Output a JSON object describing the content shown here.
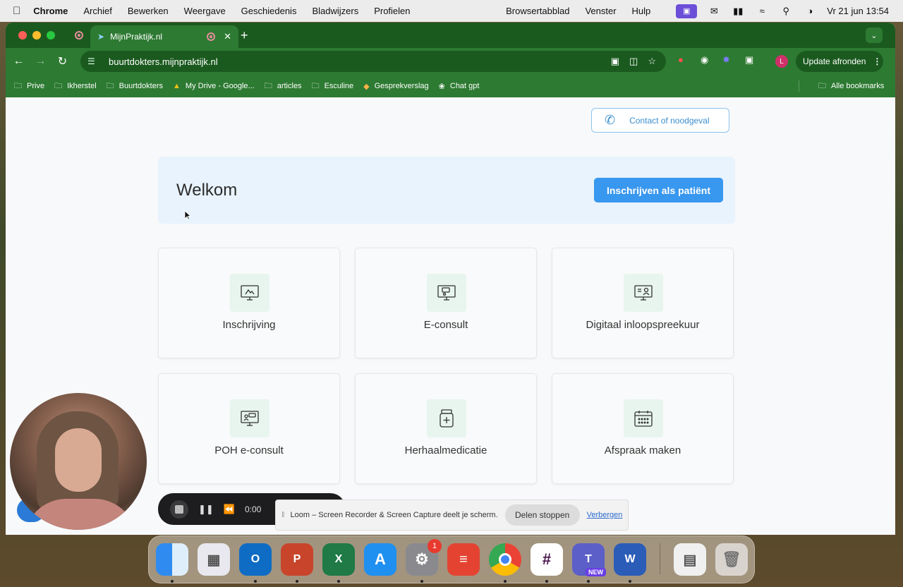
{
  "menubar": {
    "apple": "",
    "app": "Chrome",
    "items": [
      "Archief",
      "Bewerken",
      "Weergave",
      "Geschiedenis",
      "Bladwijzers",
      "Profielen"
    ],
    "right_items": [
      "Browsertabblad",
      "Venster",
      "Hulp"
    ],
    "clock": "Vr 21 jun  13:54"
  },
  "browser": {
    "tab_title": "MijnPraktijk.nl",
    "url": "buurtdokters.mijnpraktijk.nl",
    "profile_initial": "L",
    "update_label": "Update afronden",
    "bookmarks": [
      {
        "label": "Prive",
        "icon": "folder-icon"
      },
      {
        "label": "Ikherstel",
        "icon": "folder-icon"
      },
      {
        "label": "Buurtdokters",
        "icon": "folder-icon"
      },
      {
        "label": "My Drive - Google...",
        "icon": "google-drive-icon"
      },
      {
        "label": "articles",
        "icon": "folder-icon"
      },
      {
        "label": "Esculine",
        "icon": "folder-icon"
      },
      {
        "label": "Gesprekverslag",
        "icon": "gesprekverslag-icon"
      },
      {
        "label": "Chat gpt",
        "icon": "chatgpt-icon"
      }
    ],
    "all_bookmarks": "Alle bookmarks"
  },
  "page": {
    "contact_label": "Contact of noodgeval",
    "welcome_title": "Welkom",
    "signup_label": "Inschrijven als patiënt",
    "cards": [
      {
        "label": "Inschrijving",
        "icon": "inschrijving-icon"
      },
      {
        "label": "E-consult",
        "icon": "e-consult-icon"
      },
      {
        "label": "Digitaal inloopspreekuur",
        "icon": "inloopspreekuur-icon"
      },
      {
        "label": "POH e-consult",
        "icon": "poh-e-consult-icon"
      },
      {
        "label": "Herhaalmedicatie",
        "icon": "medicatie-icon"
      },
      {
        "label": "Afspraak maken",
        "icon": "calendar-icon"
      }
    ]
  },
  "loom": {
    "time": "0:00",
    "share_text": "Loom – Screen Recorder & Screen Capture deelt je scherm.",
    "stop_share": "Delen stoppen",
    "hide": "Verbergen"
  },
  "dock": {
    "apps": [
      "Finder",
      "Launchpad",
      "Outlook",
      "PowerPoint",
      "Excel",
      "App Store",
      "Systeeminstellingen",
      "Todoist",
      "Chrome",
      "Slack",
      "Teams",
      "Word",
      "Preview",
      "Prullenmand"
    ],
    "settings_badge": "1",
    "teams_badge": "NEW"
  },
  "colors": {
    "chrome_dark": "#1b5a1f",
    "chrome_green": "#2d7a32",
    "welcome_bg": "#e8f3fd",
    "primary_button": "#3897ee",
    "card_icon_bg": "#e7f5ee"
  }
}
